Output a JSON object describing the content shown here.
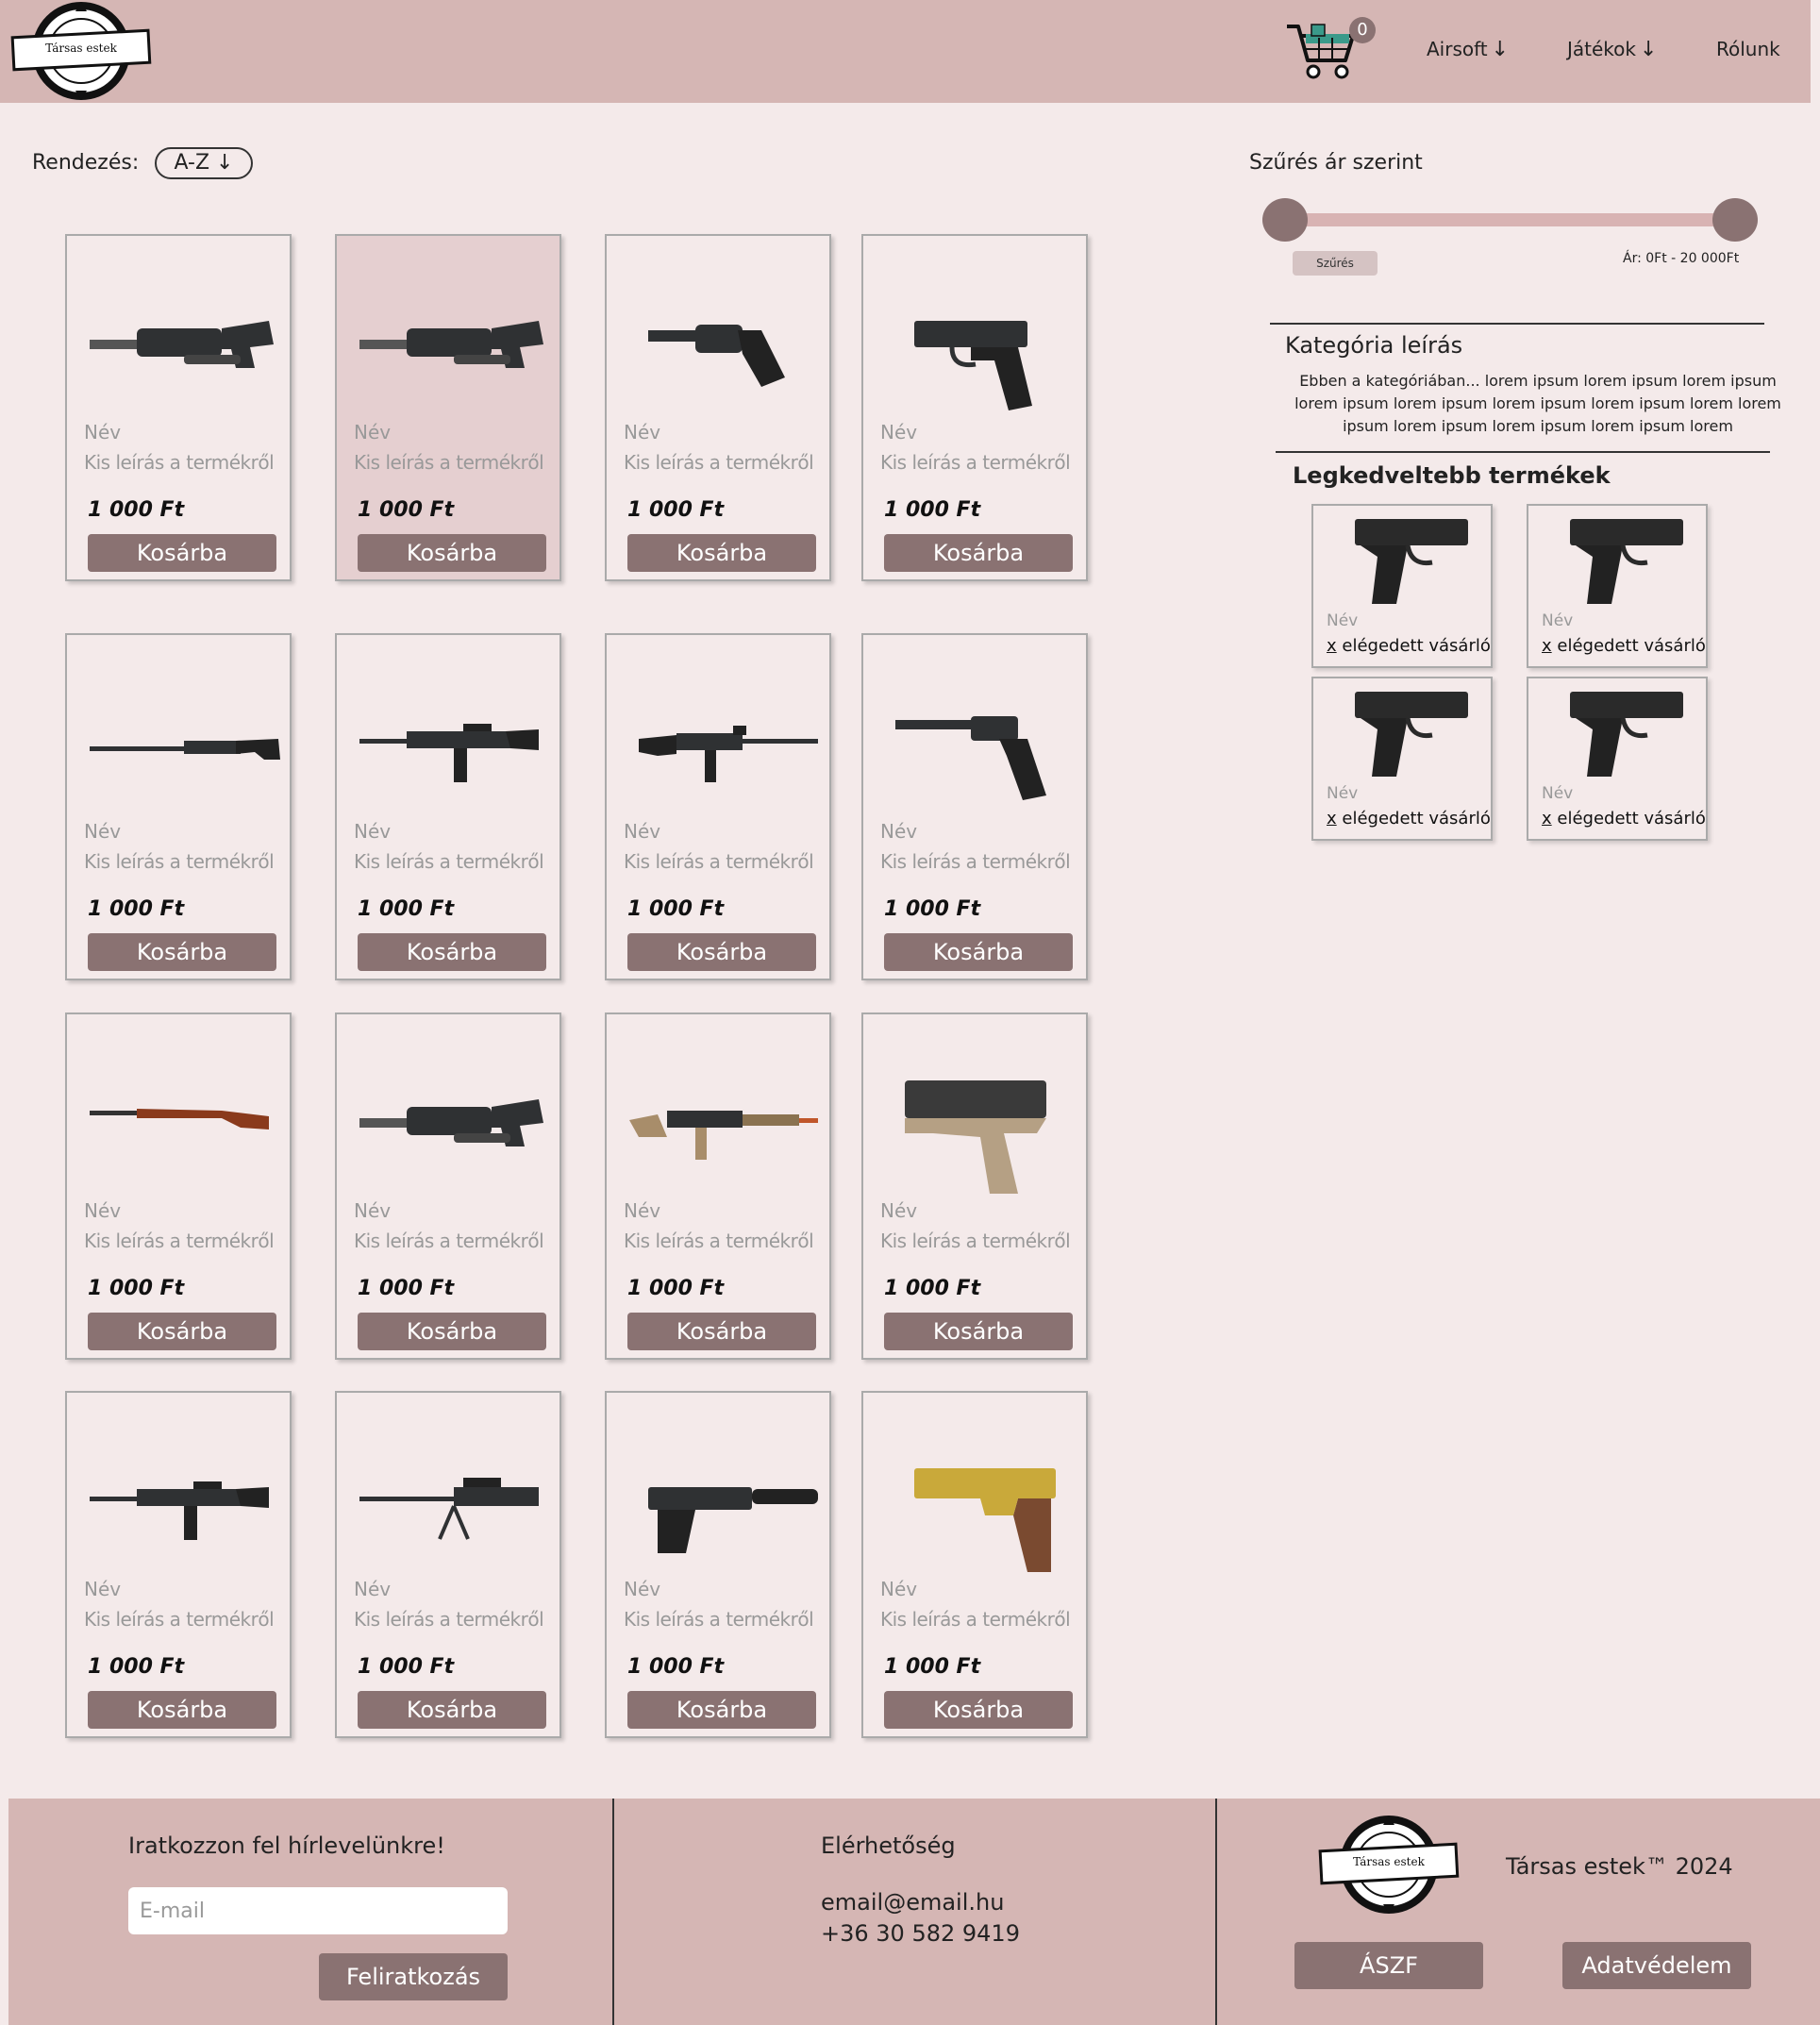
{
  "brand": {
    "logo_text": "Társas estek"
  },
  "header": {
    "cart_count": "0",
    "nav": [
      {
        "label": "Airsoft",
        "arrow": "↓"
      },
      {
        "label": "Játékok",
        "arrow": "↓"
      },
      {
        "label": "Rólunk",
        "arrow": ""
      }
    ]
  },
  "sort": {
    "label": "Rendezés:",
    "value": "A-Z ↓"
  },
  "products": [
    {
      "name": "Név",
      "desc": "Kis leírás a termékről",
      "price": "1 000 Ft",
      "button": "Kosárba",
      "image": "grenade-launcher-icon"
    },
    {
      "name": "Név",
      "desc": "Kis leírás a termékről",
      "price": "1 000 Ft",
      "button": "Kosárba",
      "image": "grenade-launcher-icon"
    },
    {
      "name": "Név",
      "desc": "Kis leírás a termékről",
      "price": "1 000 Ft",
      "button": "Kosárba",
      "image": "revolver-icon"
    },
    {
      "name": "Név",
      "desc": "Kis leírás a termékről",
      "price": "1 000 Ft",
      "button": "Kosárba",
      "image": "pistol-icon"
    },
    {
      "name": "Név",
      "desc": "Kis leírás a termékről",
      "price": "1 000 Ft",
      "button": "Kosárba",
      "image": "sniper-rifle-icon"
    },
    {
      "name": "Név",
      "desc": "Kis leírás a termékről",
      "price": "1 000 Ft",
      "button": "Kosárba",
      "image": "assault-rifle-icon"
    },
    {
      "name": "Név",
      "desc": "Kis leírás a termékről",
      "price": "1 000 Ft",
      "button": "Kosárba",
      "image": "carbine-icon"
    },
    {
      "name": "Név",
      "desc": "Kis leírás a termékről",
      "price": "1 000 Ft",
      "button": "Kosárba",
      "image": "luger-pistol-icon"
    },
    {
      "name": "Név",
      "desc": "Kis leírás a termékről",
      "price": "1 000 Ft",
      "button": "Kosárba",
      "image": "bolt-action-rifle-icon"
    },
    {
      "name": "Név",
      "desc": "Kis leírás a termékről",
      "price": "1 000 Ft",
      "button": "Kosárba",
      "image": "grenade-launcher-icon"
    },
    {
      "name": "Név",
      "desc": "Kis leírás a termékről",
      "price": "1 000 Ft",
      "button": "Kosárba",
      "image": "tan-rifle-icon"
    },
    {
      "name": "Név",
      "desc": "Kis leírás a termékről",
      "price": "1 000 Ft",
      "button": "Kosárba",
      "image": "tan-pistol-icon"
    },
    {
      "name": "Név",
      "desc": "Kis leírás a termékről",
      "price": "1 000 Ft",
      "button": "Kosárba",
      "image": "assault-rifle-icon"
    },
    {
      "name": "Név",
      "desc": "Kis leírás a termékről",
      "price": "1 000 Ft",
      "button": "Kosárba",
      "image": "anti-materiel-rifle-icon"
    },
    {
      "name": "Név",
      "desc": "Kis leírás a termékről",
      "price": "1 000 Ft",
      "button": "Kosárba",
      "image": "suppressed-pistol-icon"
    },
    {
      "name": "Név",
      "desc": "Kis leírás a termékről",
      "price": "1 000 Ft",
      "button": "Kosárba",
      "image": "gold-pistol-icon"
    }
  ],
  "filter": {
    "title": "Szűrés ár szerint",
    "button": "Szűrés",
    "range_text": "Ár: 0Ft - 20 000Ft",
    "min_value": 0,
    "max_value": 20000
  },
  "category": {
    "title": "Kategória leírás",
    "description": "Ebben a kategóriában... lorem ipsum lorem ipsum lorem ipsum lorem ipsum lorem ipsum lorem ipsum lorem ipsum lorem lorem ipsum lorem ipsum lorem ipsum lorem ipsum lorem"
  },
  "favorites": {
    "title": "Legkedveltebb termékek",
    "items": [
      {
        "name": "Név",
        "x": "x",
        "satisfied": " elégedett vásárló"
      },
      {
        "name": "Név",
        "x": "x",
        "satisfied": " elégedett vásárló"
      },
      {
        "name": "Név",
        "x": "x",
        "satisfied": " elégedett vásárló"
      },
      {
        "name": "Név",
        "x": "x",
        "satisfied": " elégedett vásárló"
      }
    ]
  },
  "footer": {
    "newsletter_title": "Iratkozzon fel hírlevelünkre!",
    "email_placeholder": "E-mail",
    "subscribe": "Feliratkozás",
    "contact_title": "Elérhetőség",
    "contact_email": "email@email.hu",
    "contact_phone": "+36 30 582 9419",
    "copyright": "Társas estek™ 2024",
    "terms": "ÁSZF",
    "privacy": "Adatvédelem"
  },
  "colors": {
    "header_bg": "#d5b6b4",
    "page_bg": "#f4eaea",
    "button": "#8a7272",
    "highlight_card": "#e5cfd0"
  }
}
